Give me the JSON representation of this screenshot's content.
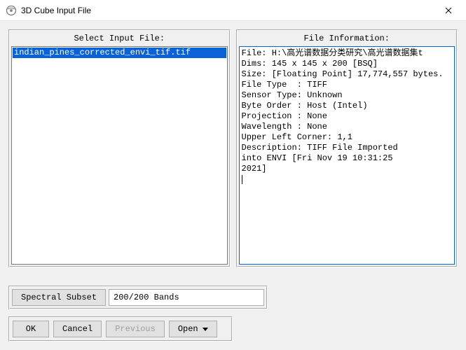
{
  "window": {
    "title": "3D Cube Input File"
  },
  "panels": {
    "select": {
      "header": "Select Input File:",
      "items": [
        {
          "name": "indian_pines_corrected_envi_tif.tif",
          "selected": true
        }
      ]
    },
    "info": {
      "header": "File Information:",
      "text": "File: H:\\高光谱数据分类研究\\高光谱数据集t\nDims: 145 x 145 x 200 [BSQ]\nSize: [Floating Point] 17,774,557 bytes.\nFile Type  : TIFF\nSensor Type: Unknown\nByte Order : Host (Intel)\nProjection : None\nWavelength : None\nUpper Left Corner: 1,1\nDescription: TIFF File Imported\ninto ENVI [Fri Nov 19 10:31:25\n2021]"
    }
  },
  "subset": {
    "button": "Spectral Subset",
    "value": "200/200 Bands"
  },
  "buttons": {
    "ok": "OK",
    "cancel": "Cancel",
    "previous": "Previous",
    "open": "Open"
  }
}
